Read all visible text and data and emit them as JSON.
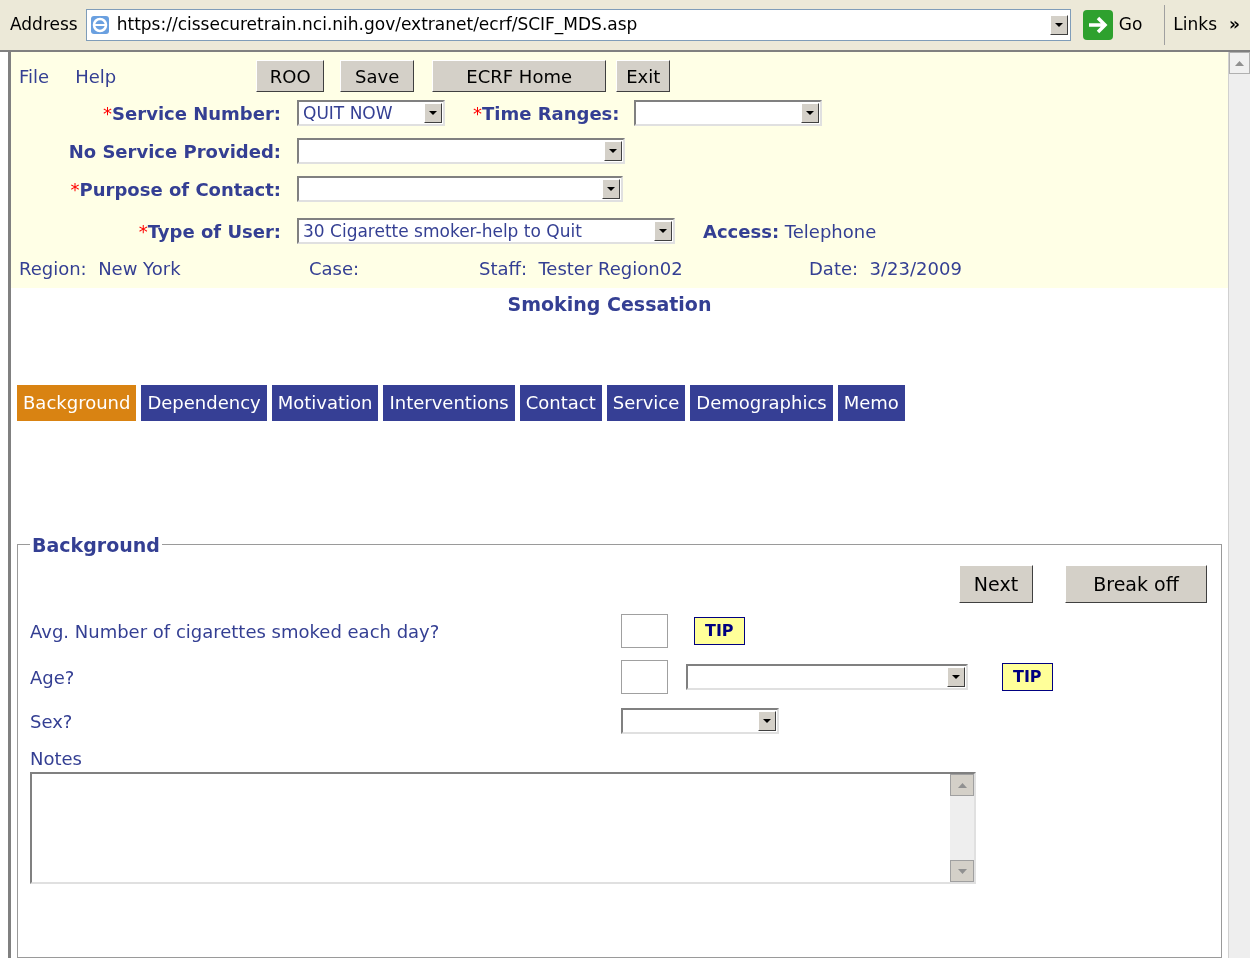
{
  "address_bar": {
    "label": "Address",
    "url": "https://cissecuretrain.nci.nih.gov/extranet/ecrf/SCIF_MDS.asp",
    "go": "Go",
    "links": "Links",
    "more": "»"
  },
  "menu": [
    "File",
    "Help"
  ],
  "toolbar_buttons": [
    "ROO",
    "Save",
    "ECRF Home",
    "Exit"
  ],
  "form_rows": [
    {
      "fields": [
        {
          "label": "Service Number:",
          "required_mark": "*",
          "value": "QUIT NOW"
        },
        {
          "label": "Time Ranges:",
          "required_mark": "*"
        }
      ]
    },
    {
      "fields": [
        {
          "label": "No Service Provided:"
        }
      ]
    },
    {
      "fields": [
        {
          "label": "Purpose of Contact:",
          "required_mark": "*"
        }
      ]
    },
    {
      "fields": [
        {
          "label": "Type of User:",
          "required_mark": "*",
          "value": "30 Cigarette smoker-help to Quit"
        }
      ],
      "access": {
        "label": "Access:",
        "value": "Telephone"
      }
    }
  ],
  "info": [
    {
      "label": "Region:",
      "value": "New York"
    },
    {
      "label": "Case:"
    },
    {
      "label": "Staff:",
      "value": "Tester Region02"
    },
    {
      "label": "Date:",
      "value": "3/23/2009"
    }
  ],
  "title": "Smoking Cessation",
  "tabs": [
    {
      "label": "Background",
      "selected": true
    },
    {
      "label": "Dependency",
      "selected": false
    },
    {
      "label": "Motivation",
      "selected": false
    },
    {
      "label": "Interventions",
      "selected": false
    },
    {
      "label": "Contact",
      "selected": false
    },
    {
      "label": "Service",
      "selected": false
    },
    {
      "label": "Demographics",
      "selected": false
    },
    {
      "label": "Memo",
      "selected": false
    }
  ],
  "section": {
    "legend": "Background",
    "buttons": [
      "Next",
      "Break off"
    ],
    "questions": [
      {
        "kind": "number",
        "label": "Avg. Number of cigarettes smoked each day?",
        "tip": "TIP"
      },
      {
        "kind": "number_select",
        "label": "Age?",
        "tip": "TIP"
      },
      {
        "kind": "select",
        "label": "Sex?"
      }
    ],
    "notes_label": "Notes"
  }
}
